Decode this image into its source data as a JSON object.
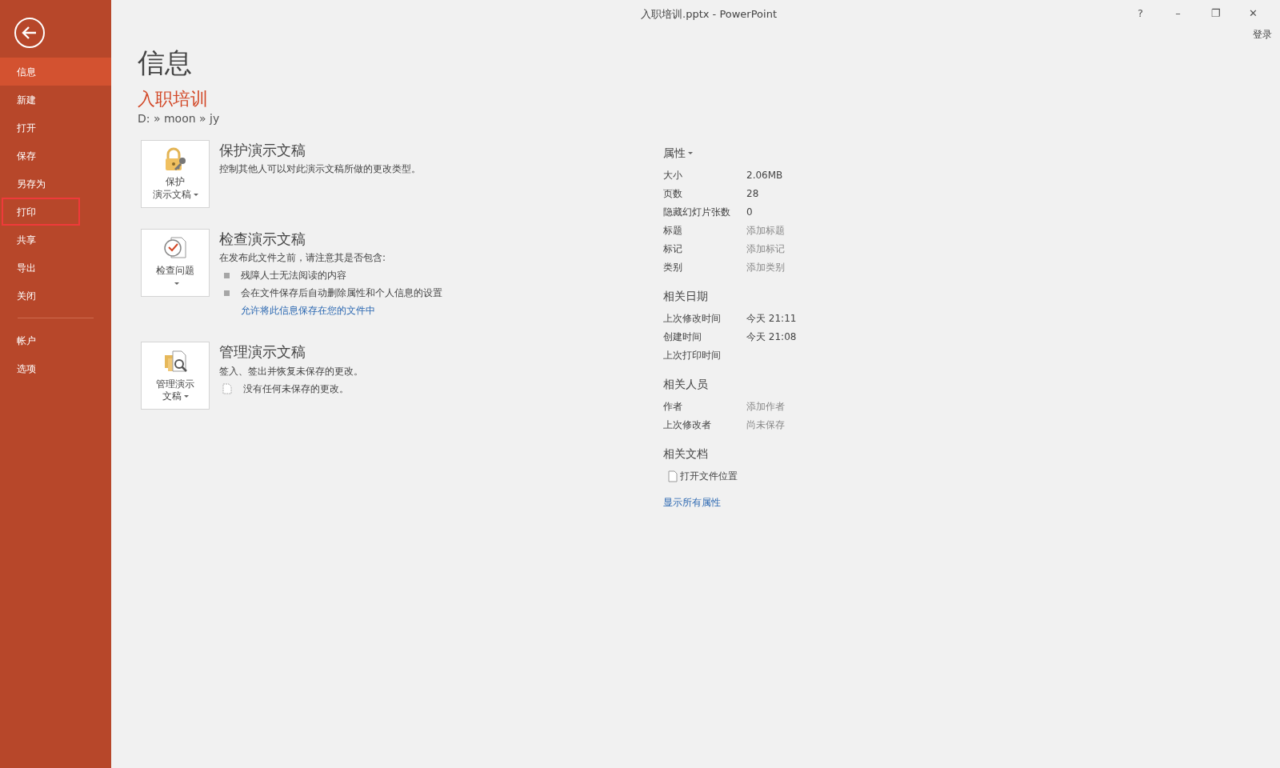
{
  "window": {
    "title": "入职培训.pptx - PowerPoint",
    "controls": [
      "?",
      "–",
      "❐",
      "✕"
    ],
    "sign_in": "登录"
  },
  "sidebar": {
    "items": [
      {
        "label": "信息",
        "selected": true,
        "outlined": false
      },
      {
        "label": "新建",
        "selected": false,
        "outlined": false
      },
      {
        "label": "打开",
        "selected": false,
        "outlined": false
      },
      {
        "label": "保存",
        "selected": false,
        "outlined": false
      },
      {
        "label": "另存为",
        "selected": false,
        "outlined": false
      },
      {
        "label": "打印",
        "selected": false,
        "outlined": true
      },
      {
        "label": "共享",
        "selected": false,
        "outlined": false
      },
      {
        "label": "导出",
        "selected": false,
        "outlined": false
      },
      {
        "label": "关闭",
        "selected": false,
        "outlined": false
      }
    ],
    "bottom_items": [
      {
        "label": "帐户",
        "selected": false,
        "outlined": false
      },
      {
        "label": "选项",
        "selected": false,
        "outlined": false
      }
    ]
  },
  "page_title": "信息",
  "document": {
    "name": "入职培训",
    "path": "D: » moon » jy"
  },
  "sections": [
    {
      "kind": "protect",
      "button_lines": [
        "保护",
        "演示文稿"
      ],
      "title": "保护演示文稿",
      "description": "控制其他人可以对此演示文稿所做的更改类型。"
    },
    {
      "kind": "inspect",
      "button_lines": [
        "检查问题"
      ],
      "title": "检查演示文稿",
      "description": "在发布此文件之前，请注意其是否包含:",
      "bullets": [
        "残障人士无法阅读的内容",
        "会在文件保存后自动删除属性和个人信息的设置"
      ],
      "link": "允许将此信息保存在您的文件中"
    },
    {
      "kind": "manage",
      "button_lines": [
        "管理演示",
        "文稿"
      ],
      "title": "管理演示文稿",
      "description": "签入、签出并恢复未保存的更改。",
      "note": "没有任何未保存的更改。"
    }
  ],
  "properties": {
    "heading": "属性",
    "rows": [
      {
        "label": "大小",
        "value": "2.06MB",
        "muted": false
      },
      {
        "label": "页数",
        "value": "28",
        "muted": false
      },
      {
        "label": "隐藏幻灯片张数",
        "value": "0",
        "muted": false
      },
      {
        "label": "标题",
        "value": "添加标题",
        "muted": true
      },
      {
        "label": "标记",
        "value": "添加标记",
        "muted": true
      },
      {
        "label": "类别",
        "value": "添加类别",
        "muted": true
      }
    ]
  },
  "related_dates": {
    "heading": "相关日期",
    "rows": [
      {
        "label": "上次修改时间",
        "value": "今天 21:11",
        "muted": false
      },
      {
        "label": "创建时间",
        "value": "今天 21:08",
        "muted": false
      },
      {
        "label": "上次打印时间"
      }
    ]
  },
  "related_people": {
    "heading": "相关人员",
    "rows": [
      {
        "label": "作者",
        "value": "添加作者",
        "muted": true
      },
      {
        "label": "上次修改者",
        "value": "尚未保存",
        "muted": true
      }
    ]
  },
  "related_documents": {
    "heading": "相关文档",
    "items": [
      "打开文件位置"
    ]
  },
  "show_all_link": "显示所有属性"
}
